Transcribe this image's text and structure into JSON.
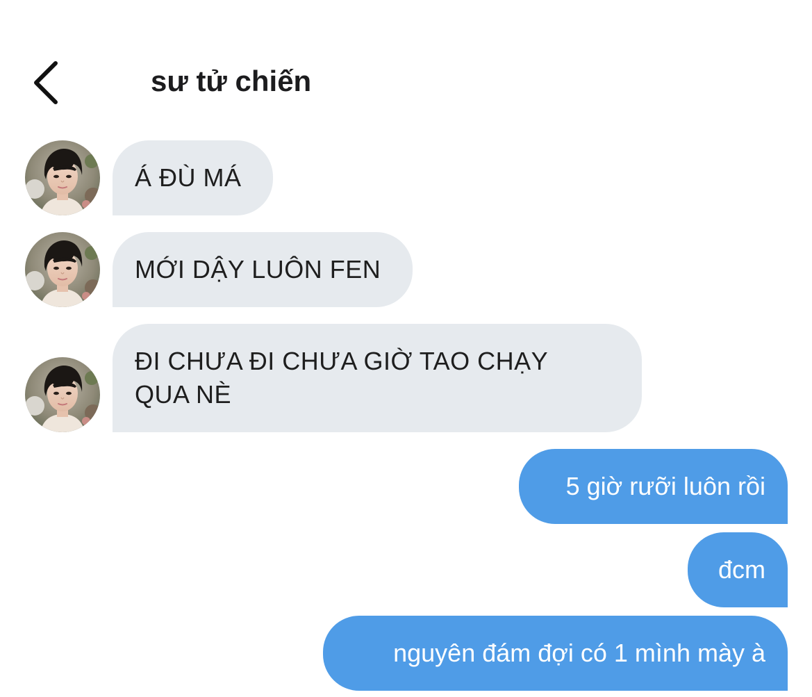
{
  "header": {
    "back_icon": "chevron-left-icon",
    "title": "sư tử chiến"
  },
  "colors": {
    "incoming_bubble": "#e6eaee",
    "outgoing_bubble": "#4f9ce7",
    "incoming_text": "#1e1e1e",
    "outgoing_text": "#ffffff"
  },
  "messages": [
    {
      "direction": "incoming",
      "text": "Á ĐÙ MÁ"
    },
    {
      "direction": "incoming",
      "text": "MỚI DẬY LUÔN FEN"
    },
    {
      "direction": "incoming",
      "text": "ĐI CHƯA ĐI CHƯA GIỜ TAO CHẠY QUA NÈ"
    },
    {
      "direction": "outgoing",
      "text": "5 giờ rưỡi luôn rồi"
    },
    {
      "direction": "outgoing",
      "text": "đcm"
    },
    {
      "direction": "outgoing",
      "text": "nguyên đám đợi có 1 mình mày à"
    }
  ]
}
